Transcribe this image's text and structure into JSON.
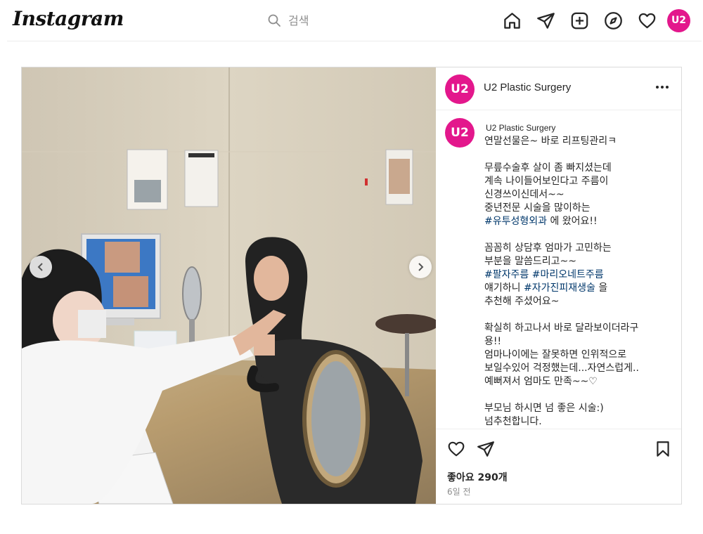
{
  "nav": {
    "logo": "Instagram",
    "search_placeholder": "검색",
    "avatar_text": "U2"
  },
  "post": {
    "account_name": "U2 Plastic Surgery",
    "avatar_text": "U2",
    "caption": {
      "username": "U2 Plastic Surgery",
      "lines": [
        {
          "text": "연말선물은~ 바로 리프팅관리ㅋ",
          "tags": []
        },
        {
          "text": "",
          "tags": []
        },
        {
          "text": "무릎수술후 살이 좀 빠지셨는데",
          "tags": []
        },
        {
          "text": "계속 나이들어보인다고 주름이",
          "tags": []
        },
        {
          "text": "신경쓰이신데서~~",
          "tags": []
        },
        {
          "text": "중년전문 시술을 많이하는",
          "tags": []
        },
        {
          "text": "",
          "tags": [
            "#유투성형외과"
          ],
          "after": " 에 왔어요!!"
        },
        {
          "text": "",
          "tags": []
        },
        {
          "text": "꼼꼼히 상담후 엄마가 고민하는",
          "tags": []
        },
        {
          "text": "부분을 말씀드리고~~",
          "tags": []
        },
        {
          "text": "",
          "tags": [
            "#팔자주름",
            "#마리오네트주름"
          ],
          "after": ""
        },
        {
          "text": "얘기하니 ",
          "tags": [
            "#자가진피재생술"
          ],
          "after": " 을"
        },
        {
          "text": "추천해 주셨어요~",
          "tags": []
        },
        {
          "text": "",
          "tags": []
        },
        {
          "text": "확실히 하고나서 바로 달라보이더라구",
          "tags": []
        },
        {
          "text": "용!!",
          "tags": []
        },
        {
          "text": "엄마나이에는 잘못하면 인위적으로",
          "tags": []
        },
        {
          "text": "보일수있어 걱정했는데...자연스럽게..",
          "tags": []
        },
        {
          "text": "예뻐져서 엄마도 만족~~♡",
          "tags": []
        },
        {
          "text": "",
          "tags": []
        },
        {
          "text": "부모님 하시면 넘 좋은 시술:)",
          "tags": []
        },
        {
          "text": "넘추천합니다.",
          "tags": []
        }
      ]
    },
    "likes_text": "좋아요 290개",
    "time_text": "6일 전"
  },
  "icons": {
    "nav": [
      "home-icon",
      "send-icon",
      "new-post-icon",
      "explore-icon",
      "heart-icon"
    ],
    "actions": [
      "like-icon",
      "share-icon",
      "save-icon"
    ]
  },
  "colors": {
    "brand_pink": "#e3178c",
    "hashtag": "#00376b",
    "muted": "#8e8e8e"
  }
}
